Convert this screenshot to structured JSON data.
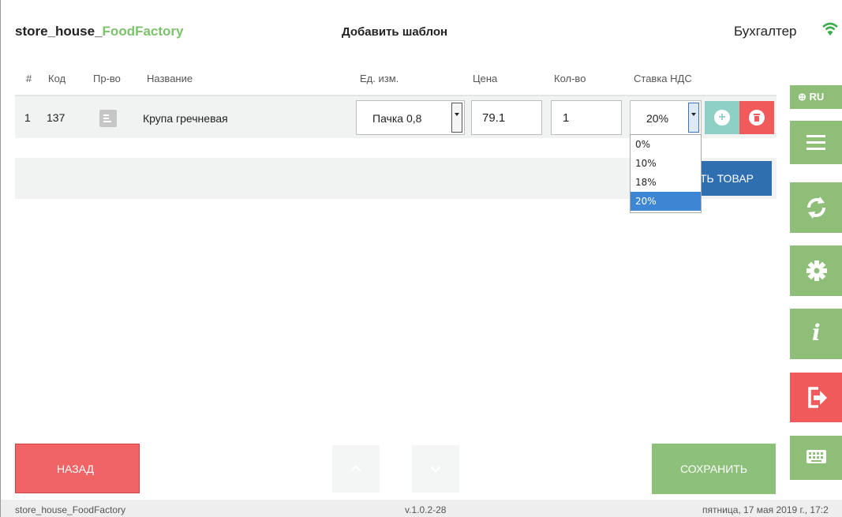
{
  "header": {
    "brand_prefix": "store_house_",
    "brand_highlight": "FoodFactory",
    "page_title": "Добавить шаблон",
    "user_role": "Бухгалтер"
  },
  "table": {
    "columns": [
      "#",
      "Код",
      "Пр-во",
      "Название",
      "Ед. изм.",
      "Цена",
      "Кол-во",
      "Ставка НДС"
    ],
    "rows": [
      {
        "index": "1",
        "code": "137",
        "name": "Крупа гречневая",
        "unit": "Пачка 0,8",
        "price": "79.1",
        "quantity": "1",
        "vat": "20%"
      }
    ]
  },
  "vat_dropdown": {
    "options": [
      "0%",
      "10%",
      "18%",
      "20%"
    ],
    "selected": "20%"
  },
  "add_item_button": "ТЬ ТОВАР",
  "side_panel": {
    "language": "RU",
    "icons": [
      "menu-icon",
      "sync-icon",
      "gear-icon",
      "info-icon",
      "logout-icon",
      "keyboard-icon"
    ],
    "colors": {
      "green": "#8fbe78",
      "red": "#f05a5b"
    }
  },
  "footer": {
    "back_label": "НАЗАД",
    "save_label": "СОХРАНИТЬ"
  },
  "status_bar": {
    "app_name": "store_house_FoodFactory",
    "version": "v.1.0.2-28",
    "datetime": "пятница, 17 мая 2019 г., 17:2"
  },
  "colors": {
    "accent_green": "#7cc26b",
    "add_button_blue": "#2f6fb0",
    "back_red": "#f06466",
    "save_green": "#8cc07b",
    "add_row_teal": "#8ed0c6",
    "delete_red": "#f05a5b"
  }
}
